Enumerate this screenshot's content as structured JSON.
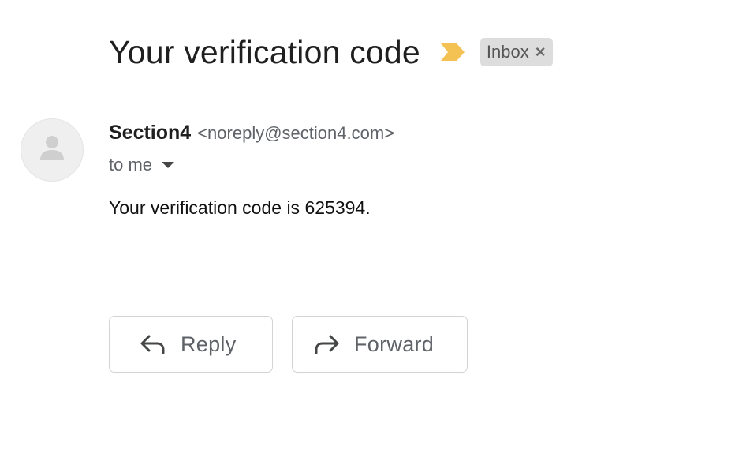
{
  "email": {
    "subject": "Your verification code",
    "label": {
      "name": "Inbox",
      "remove_glyph": "×"
    },
    "importance_marker": {
      "icon": "importance-marker-icon",
      "color": "#f4c153"
    },
    "sender": {
      "avatar_icon": "person-icon",
      "name": "Section4",
      "email": "<noreply@section4.com>"
    },
    "recipient": {
      "text": "to me",
      "icon": "caret-down-icon"
    },
    "body": "Your verification code is 625394."
  },
  "actions": {
    "reply": {
      "label": "Reply",
      "icon": "reply-arrow-icon"
    },
    "forward": {
      "label": "Forward",
      "icon": "forward-arrow-icon"
    }
  }
}
